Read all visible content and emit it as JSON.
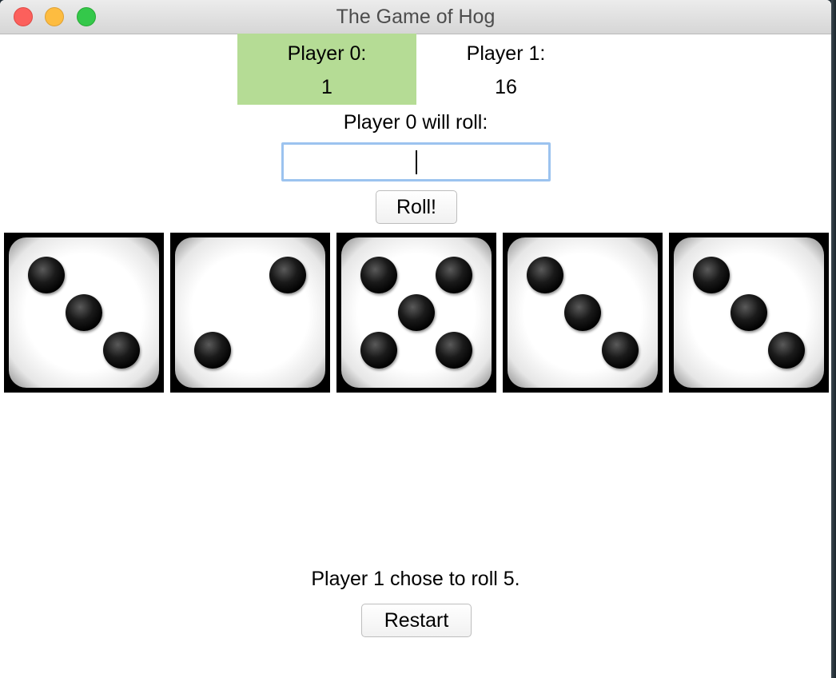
{
  "window": {
    "title": "The Game of Hog"
  },
  "scores": [
    {
      "label": "Player 0:",
      "value": "1",
      "active": true
    },
    {
      "label": "Player 1:",
      "value": "16",
      "active": false
    }
  ],
  "prompt": "Player 0 will roll:",
  "roll_input": {
    "value": "",
    "placeholder": ""
  },
  "roll_button": "Roll!",
  "dice": [
    3,
    2,
    5,
    3,
    3
  ],
  "status_message": "Player 1 chose to roll 5.",
  "restart_button": "Restart",
  "colors": {
    "active_player_bg": "#b5dc95",
    "input_focus_border": "#9cc3ef"
  }
}
